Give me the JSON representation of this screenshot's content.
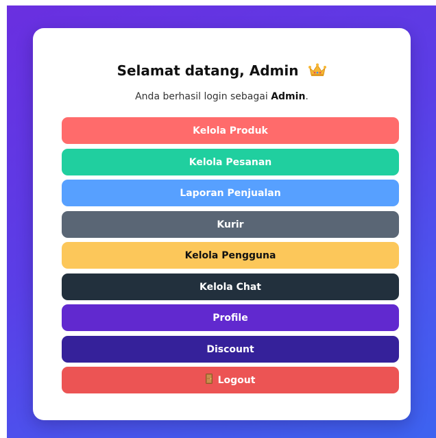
{
  "welcome": {
    "title": "Selamat datang, Admin",
    "crown_icon": "crown-icon",
    "subtitle_prefix": "Anda berhasil login sebagai ",
    "subtitle_role": "Admin",
    "subtitle_suffix": "."
  },
  "menu": [
    {
      "label": "Kelola Produk",
      "color": "#ff6b6b",
      "text_color": "#ffffff"
    },
    {
      "label": "Kelola Pesanan",
      "color": "#20cf9f",
      "text_color": "#ffffff"
    },
    {
      "label": "Laporan Penjualan",
      "color": "#57a0ff",
      "text_color": "#ffffff"
    },
    {
      "label": "Kurir",
      "color": "#5a6675",
      "text_color": "#ffffff"
    },
    {
      "label": "Kelola Pengguna",
      "color": "#fcc75a",
      "text_color": "#111111"
    },
    {
      "label": "Kelola Chat",
      "color": "#22303d",
      "text_color": "#ffffff"
    },
    {
      "label": "Profile",
      "color": "#6129cf",
      "text_color": "#ffffff"
    },
    {
      "label": "Discount",
      "color": "#35219a",
      "text_color": "#ffffff"
    },
    {
      "label": "Logout",
      "color": "#ec5454",
      "text_color": "#ffffff",
      "icon": "door-icon"
    }
  ],
  "colors": {
    "background_start": "#6a2fe0",
    "background_end": "#3d63f0",
    "card": "#ffffff"
  }
}
